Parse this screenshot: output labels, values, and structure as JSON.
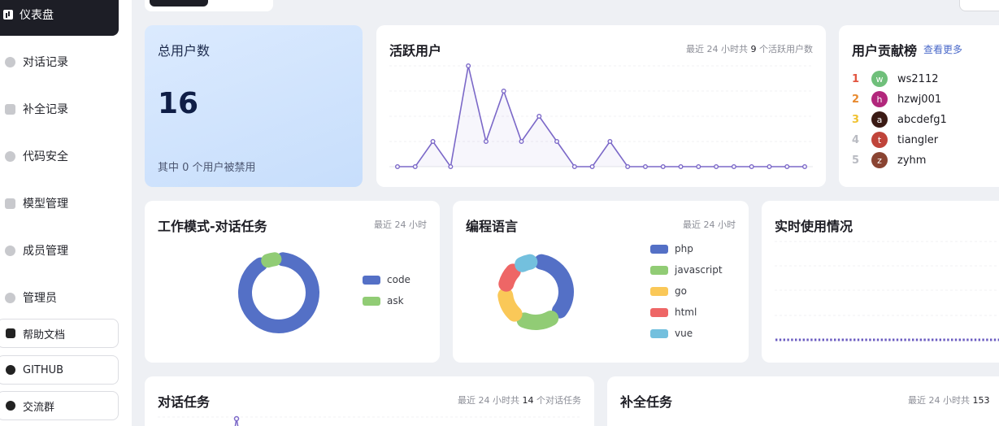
{
  "sidebar": {
    "active": "仪表盘",
    "items": [
      "对话记录",
      "补全记录",
      "代码安全",
      "模型管理",
      "成员管理",
      "管理员"
    ],
    "buttons": [
      "帮助文档",
      "GITHUB",
      "交流群"
    ]
  },
  "total_users": {
    "title": "总用户数",
    "value": "16",
    "note": "其中 0 个用户被禁用"
  },
  "active_users": {
    "title": "活跃用户",
    "note_prefix": "最近 24 小时共",
    "note_count": "9",
    "note_suffix": "个活跃用户数"
  },
  "contrib": {
    "title": "用户贡献榜",
    "more": "查看更多",
    "users": [
      {
        "rank": "1",
        "initial": "w",
        "name": "ws2112",
        "color": "#6fbf7a",
        "rank_color": "#e25540"
      },
      {
        "rank": "2",
        "initial": "h",
        "name": "hzwj001",
        "color": "#b2277c",
        "rank_color": "#e88a2f"
      },
      {
        "rank": "3",
        "initial": "a",
        "name": "abcdefg1",
        "color": "#3a1a14",
        "rank_color": "#f0c232"
      },
      {
        "rank": "4",
        "initial": "t",
        "name": "tiangler",
        "color": "#c0443a",
        "rank_color": "#b9bbc2"
      },
      {
        "rank": "5",
        "initial": "z",
        "name": "zyhm",
        "color": "#8a4432",
        "rank_color": "#b9bbc2"
      }
    ]
  },
  "work_mode": {
    "title": "工作模式-对话任务",
    "note": "最近 24 小时"
  },
  "lang": {
    "title": "编程语言",
    "note": "最近 24 小时"
  },
  "realtime": {
    "title": "实时使用情况"
  },
  "chat_tasks": {
    "title": "对话任务",
    "note_prefix": "最近 24 小时共",
    "note_count": "14",
    "note_suffix": "个对话任务"
  },
  "completion": {
    "title": "补全任务",
    "note_prefix": "最近 24 小时共",
    "note_count": "153"
  },
  "chart_data": [
    {
      "type": "line",
      "name": "active-users",
      "values": [
        0,
        0,
        1,
        0,
        4,
        1,
        3,
        1,
        2,
        1,
        0,
        0,
        1,
        0,
        0,
        0,
        0,
        0,
        0,
        0,
        0,
        0,
        0,
        0
      ],
      "color": "#7b68c8"
    },
    {
      "type": "pie",
      "name": "work-mode",
      "labels": [
        "code",
        "ask"
      ],
      "values": [
        13,
        1
      ],
      "colors": [
        "#5470c6",
        "#91cc75"
      ]
    },
    {
      "type": "pie",
      "name": "programming-language",
      "labels": [
        "php",
        "javascript",
        "go",
        "html",
        "vue"
      ],
      "values": [
        34,
        18,
        15,
        12,
        9
      ],
      "colors": [
        "#5470c6",
        "#91cc75",
        "#fac858",
        "#ee6666",
        "#73c0de"
      ]
    }
  ]
}
